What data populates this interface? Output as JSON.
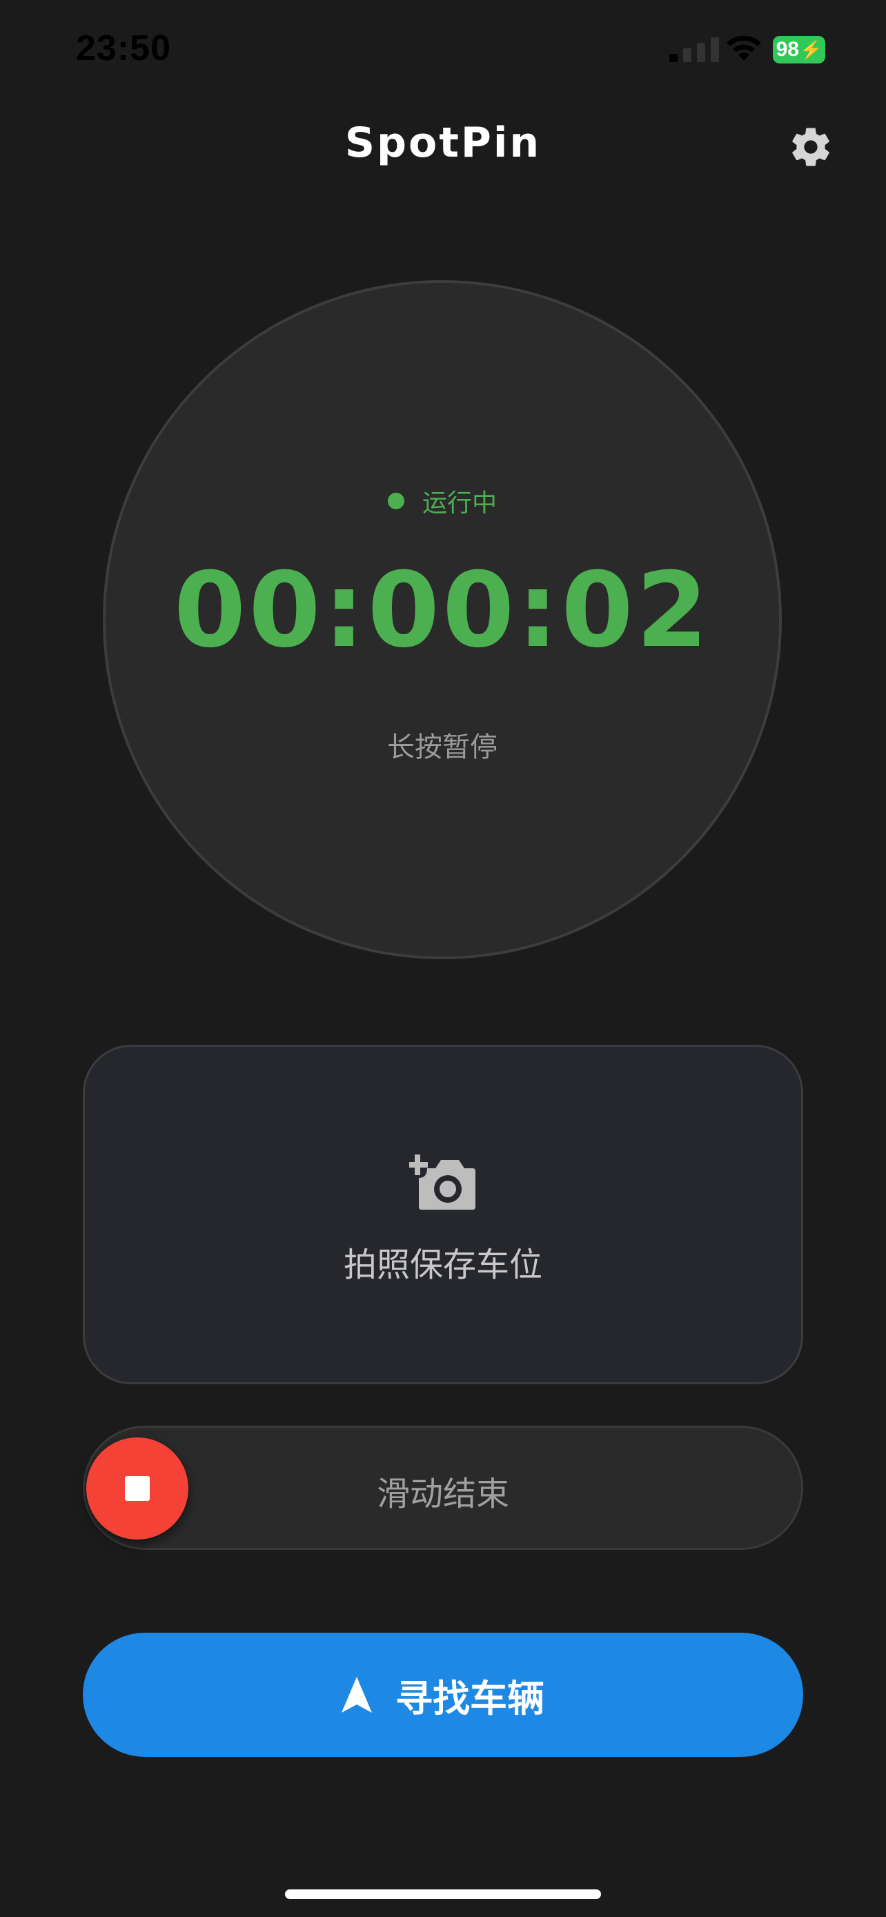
{
  "status_bar": {
    "time": "23:50",
    "battery_level": "98",
    "battery_color": "#32c759"
  },
  "header": {
    "title": "SpotPin",
    "settings_icon": "gear-icon"
  },
  "timer": {
    "status": "运行中",
    "status_color": "#4caf50",
    "elapsed": "00:00:02",
    "hint": "长按暂停"
  },
  "photo_card": {
    "icon": "camera-add-icon",
    "label": "拍照保存车位"
  },
  "slider": {
    "label": "滑动结束",
    "knob_icon": "stop-icon",
    "knob_color": "#f44336"
  },
  "find_button": {
    "icon": "navigation-arrow-icon",
    "label": "寻找车辆",
    "color": "#1e88e5"
  }
}
